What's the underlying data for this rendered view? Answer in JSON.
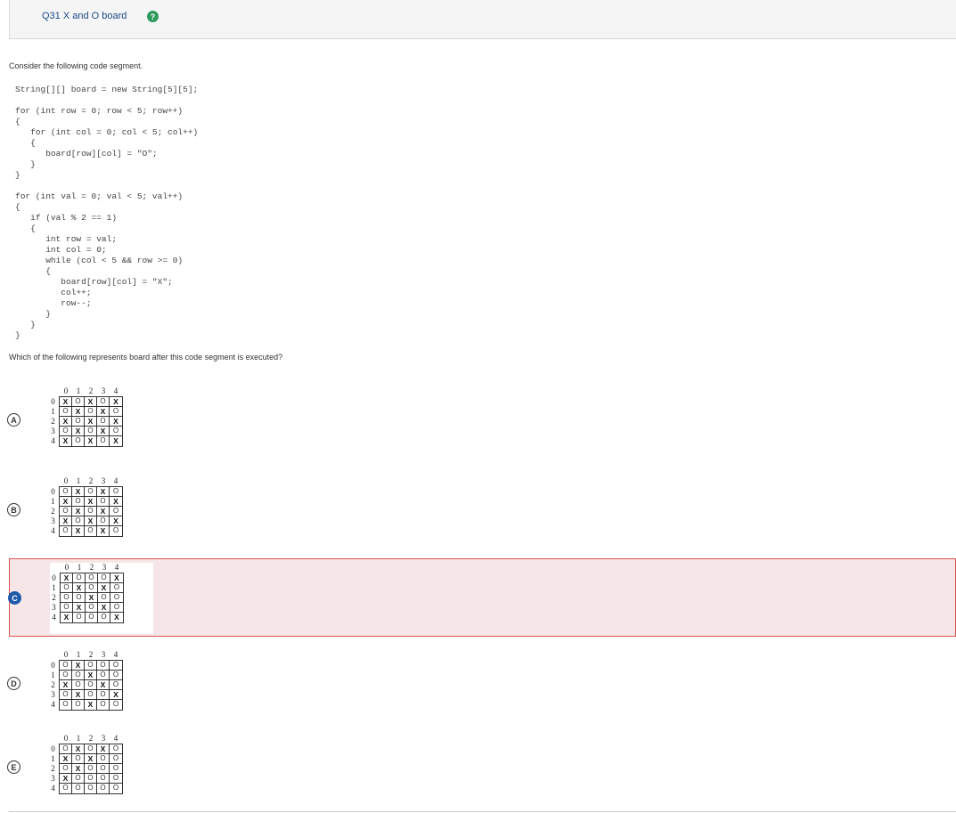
{
  "header": {
    "title": "Q31 X and O board",
    "help_icon_label": "?"
  },
  "prompt": "Consider the following code segment.",
  "code": "String[][] board = new String[5][5];\n\nfor (int row = 0; row < 5; row++)\n{\n   for (int col = 0; col < 5; col++)\n   {\n      board[row][col] = \"O\";\n   }\n}\n\nfor (int val = 0; val < 5; val++)\n{\n   if (val % 2 == 1)\n   {\n      int row = val;\n      int col = 0;\n      while (col < 5 && row >= 0)\n      {\n         board[row][col] = \"X\";\n         col++;\n         row--;\n      }\n   }\n}",
  "question": "Which of the following represents board after this code segment is executed?",
  "axis_labels": [
    "0",
    "1",
    "2",
    "3",
    "4"
  ],
  "choices": [
    {
      "letter": "A",
      "selected": false,
      "grid": [
        [
          "X",
          "O",
          "X",
          "O",
          "X"
        ],
        [
          "O",
          "X",
          "O",
          "X",
          "O"
        ],
        [
          "X",
          "O",
          "X",
          "O",
          "X"
        ],
        [
          "O",
          "X",
          "O",
          "X",
          "O"
        ],
        [
          "X",
          "O",
          "X",
          "O",
          "X"
        ]
      ]
    },
    {
      "letter": "B",
      "selected": false,
      "grid": [
        [
          "O",
          "X",
          "O",
          "X",
          "O"
        ],
        [
          "X",
          "O",
          "X",
          "O",
          "X"
        ],
        [
          "O",
          "X",
          "O",
          "X",
          "O"
        ],
        [
          "X",
          "O",
          "X",
          "O",
          "X"
        ],
        [
          "O",
          "X",
          "O",
          "X",
          "O"
        ]
      ]
    },
    {
      "letter": "C",
      "selected": true,
      "grid": [
        [
          "X",
          "O",
          "O",
          "O",
          "X"
        ],
        [
          "O",
          "X",
          "O",
          "X",
          "O"
        ],
        [
          "O",
          "O",
          "X",
          "O",
          "O"
        ],
        [
          "O",
          "X",
          "O",
          "X",
          "O"
        ],
        [
          "X",
          "O",
          "O",
          "O",
          "X"
        ]
      ]
    },
    {
      "letter": "D",
      "selected": false,
      "grid": [
        [
          "O",
          "X",
          "O",
          "O",
          "O"
        ],
        [
          "O",
          "O",
          "X",
          "O",
          "O"
        ],
        [
          "X",
          "O",
          "O",
          "X",
          "O"
        ],
        [
          "O",
          "X",
          "O",
          "O",
          "X"
        ],
        [
          "O",
          "O",
          "X",
          "O",
          "O"
        ]
      ]
    },
    {
      "letter": "E",
      "selected": false,
      "grid": [
        [
          "O",
          "X",
          "O",
          "X",
          "O"
        ],
        [
          "X",
          "O",
          "X",
          "O",
          "O"
        ],
        [
          "O",
          "X",
          "O",
          "O",
          "O"
        ],
        [
          "X",
          "O",
          "O",
          "O",
          "O"
        ],
        [
          "O",
          "O",
          "O",
          "O",
          "O"
        ]
      ]
    }
  ],
  "colors": {
    "selected_bg": "#f6e6e8",
    "selected_border": "#d9534f",
    "selected_letter": "#1d5aa8",
    "title_link": "#1a4a8a",
    "help_icon": "#2e9a5e"
  }
}
